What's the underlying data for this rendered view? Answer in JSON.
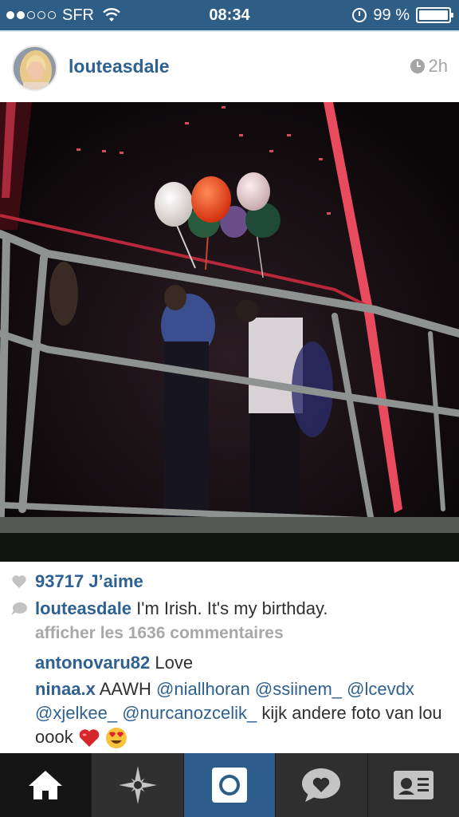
{
  "status_bar": {
    "carrier": "SFR",
    "time": "08:34",
    "battery": "99 %",
    "signal_bars_filled": 2,
    "signal_bars_total": 5
  },
  "post": {
    "username": "louteasdale",
    "time_ago": "2h",
    "likes": "93717 J’aime",
    "caption_user": "louteasdale",
    "caption_text": "I'm Irish. It's my birthday.",
    "view_comments": "afficher les 1636 commentaires",
    "comments": [
      {
        "user": "antonovaru82",
        "text": "Love"
      },
      {
        "user": "ninaa.x",
        "text_prefix": "AAWH",
        "mentions": [
          "@niallhoran",
          "@ssiinem_",
          "@lcevdx",
          "@xjelkee_",
          "@nurcanozcelik_"
        ],
        "text_suffix": "kijk andere foto van lou oook"
      }
    ]
  },
  "tabbar": {
    "items": [
      {
        "name": "home",
        "icon": "home-icon",
        "active": true
      },
      {
        "name": "explore",
        "icon": "explore-star-icon"
      },
      {
        "name": "camera",
        "icon": "camera-icon"
      },
      {
        "name": "activity",
        "icon": "activity-heart-bubble-icon"
      },
      {
        "name": "profile",
        "icon": "profile-card-icon"
      }
    ]
  },
  "colors": {
    "status_bar": "#2e5e86",
    "link_blue": "#2e6191",
    "muted": "#a8a8a8",
    "tabbar": "#2f2f2f",
    "tab_camera": "#2d5d8a"
  }
}
